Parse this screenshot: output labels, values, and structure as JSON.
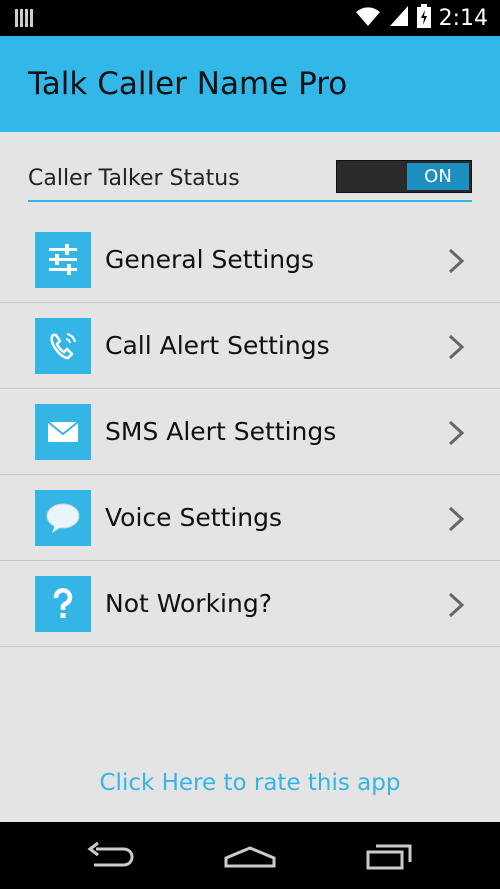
{
  "status_bar": {
    "time": "2:14"
  },
  "app": {
    "title": "Talk Caller Name Pro"
  },
  "status_row": {
    "label": "Caller Talker Status",
    "toggle_label": "ON",
    "toggle_on": true
  },
  "menu": {
    "items": [
      {
        "label": "General Settings",
        "icon": "sliders-icon"
      },
      {
        "label": "Call Alert Settings",
        "icon": "phone-icon"
      },
      {
        "label": "SMS Alert Settings",
        "icon": "envelope-icon"
      },
      {
        "label": "Voice Settings",
        "icon": "speech-bubble-icon"
      },
      {
        "label": "Not Working?",
        "icon": "question-icon"
      }
    ]
  },
  "rate_link": "Click Here to rate this app",
  "colors": {
    "accent": "#33b5e5",
    "actionbar": "#31b7e8",
    "toggle_on": "#1c8fc0",
    "background": "#e4e4e4"
  }
}
